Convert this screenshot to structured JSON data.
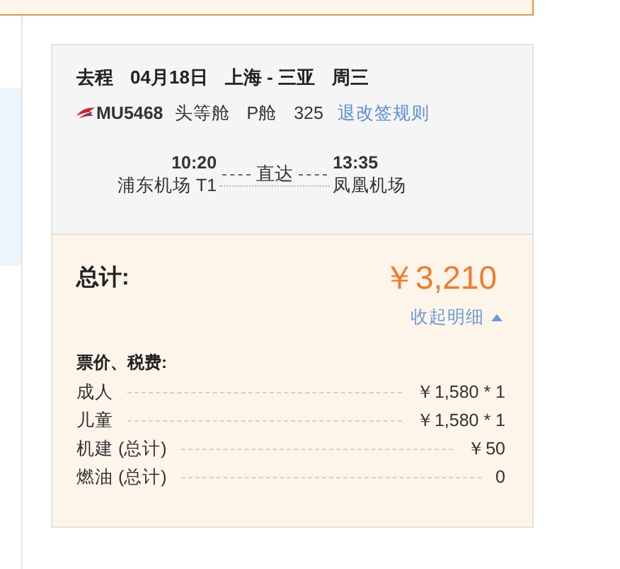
{
  "flight": {
    "direction": "去程",
    "date": "04月18日",
    "route": "上海 - 三亚",
    "weekday": "周三",
    "flight_no": "MU5468",
    "cabin": "头等舱",
    "class": "P舱",
    "aircraft": "325",
    "rules_link": "退改签规则",
    "depart": {
      "time": "10:20",
      "airport": "浦东机场 T1"
    },
    "stop": "直达",
    "arrive": {
      "time": "13:35",
      "airport": "凤凰机场"
    }
  },
  "total": {
    "label": "总计:",
    "amount": "￥3,210",
    "toggle": "收起明细",
    "expanded": true
  },
  "details": {
    "heading": "票价、税费:",
    "rows": [
      {
        "label": "成人",
        "value": "￥1,580 * 1"
      },
      {
        "label": "儿童",
        "value": "￥1,580 * 1"
      },
      {
        "label": "机建 (总计)",
        "value": "￥50"
      },
      {
        "label": "燃油 (总计)",
        "value": "0"
      }
    ]
  }
}
